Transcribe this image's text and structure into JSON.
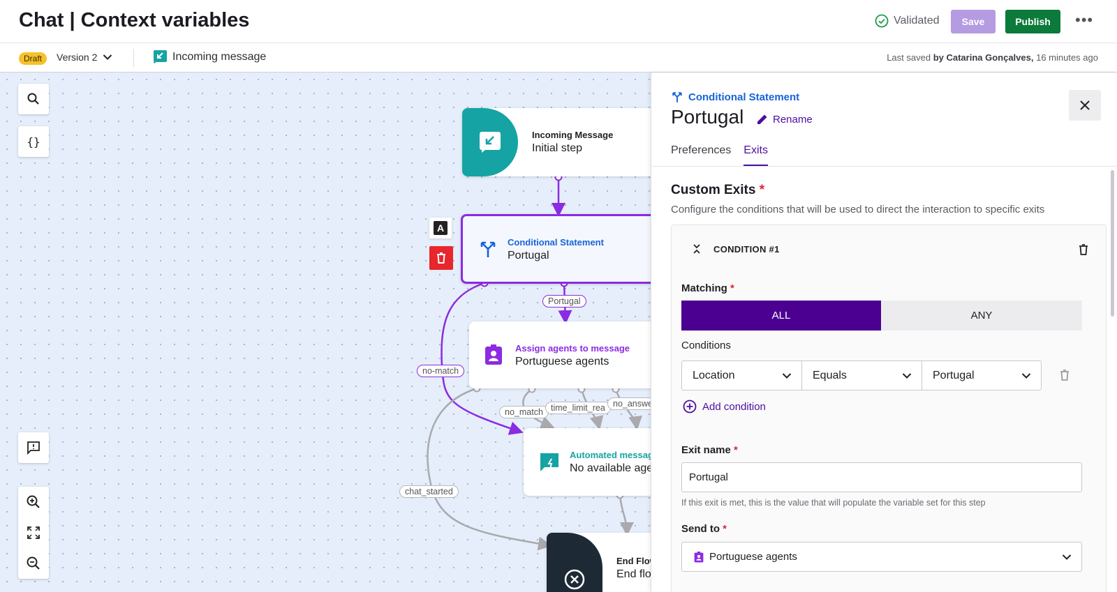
{
  "header": {
    "title": "Chat | Context variables",
    "validated_label": "Validated",
    "save_label": "Save",
    "publish_label": "Publish",
    "more_label": "•••"
  },
  "subheader": {
    "draft_badge": "Draft",
    "version_label": "Version 2",
    "trigger_label": "Incoming message",
    "last_saved_prefix": "Last saved",
    "last_saved_by": "by Catarina Gonçalves,",
    "last_saved_when": "16 minutes ago"
  },
  "canvas": {
    "nodes": {
      "incoming": {
        "type": "Incoming Message",
        "name": "Initial step"
      },
      "conditional": {
        "type": "Conditional Statement",
        "name": "Portugal"
      },
      "assign": {
        "type": "Assign agents to message",
        "name": "Portuguese agents"
      },
      "automated": {
        "type": "Automated messag",
        "name": "No available ager"
      },
      "endflow": {
        "type": "End Flow",
        "name": "End flov"
      }
    },
    "edge_labels": {
      "portugal": "Portugal",
      "no_match_purple": "no-match",
      "no_match": "no_match",
      "time_limit": "time_limit_rea",
      "no_answer": "no_answe",
      "chat_started": "chat_started"
    },
    "node_action_letter": "A"
  },
  "panel": {
    "type_label": "Conditional Statement",
    "title": "Portugal",
    "rename_label": "Rename",
    "tabs": [
      {
        "label": "Preferences",
        "active": false
      },
      {
        "label": "Exits",
        "active": true
      }
    ],
    "custom_exits_title": "Custom Exits",
    "custom_exits_desc": "Configure the conditions that will be used to direct the interaction to specific exits",
    "required_mark": "*",
    "condition": {
      "header": "CONDITION #1",
      "matching_label": "Matching",
      "matching_options": [
        "ALL",
        "ANY"
      ],
      "matching_selected": "ALL",
      "conditions_label": "Conditions",
      "field": "Location",
      "operator": "Equals",
      "value": "Portugal",
      "add_condition_label": "Add condition",
      "exit_name_label": "Exit name",
      "exit_name_value": "Portugal",
      "exit_name_hint": "If this exit is met, this is the value that will populate the variable set for this step",
      "send_to_label": "Send to",
      "send_to_value": "Portuguese agents"
    }
  },
  "colors": {
    "accent_purple": "#4b0091",
    "node_selected_border": "#8c2be2",
    "publish_green": "#0b7a3b",
    "teal": "#16a3a3",
    "link_blue": "#1864d8",
    "danger_red": "#e8262b"
  }
}
